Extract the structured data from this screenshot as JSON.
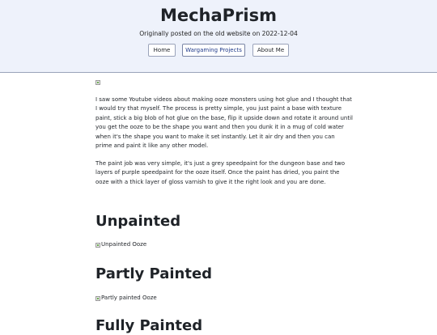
{
  "header": {
    "title": "MechaPrism",
    "subtitle": "Originally posted on the old website on 2022-12-04",
    "nav": [
      {
        "label": "Home"
      },
      {
        "label": "Wargaming Projects"
      },
      {
        "label": "About Me"
      }
    ]
  },
  "article": {
    "paragraphs": [
      "I saw some Youtube videos about making ooze monsters using hot glue and I thought that I would try that myself. The process is pretty simple, you just paint a base with texture paint, stick a big blob of hot glue on the base, flip it upside down and rotate it around until you get the ooze to be the shape you want and then you dunk it in a mug of cold water when it's the shape you want to make it set instantly. Let it air dry and then you can prime and paint it like any other model.",
      "The paint job was very simple, it's just a grey speedpaint for the dungeon base and two layers of purple speedpaint for the ooze itself. Once the paint has dried, you paint the ooze with a thick layer of gloss varnish to give it the right look and you are done."
    ],
    "sections": [
      {
        "heading": "Unpainted",
        "image_alt": "Unpainted Ooze"
      },
      {
        "heading": "Partly Painted",
        "image_alt": "Partly painted Ooze"
      },
      {
        "heading": "Fully Painted"
      }
    ]
  },
  "colors": {
    "header_bg": "#eef2fb",
    "header_border": "#9aa3ba",
    "text": "#1f2328"
  }
}
